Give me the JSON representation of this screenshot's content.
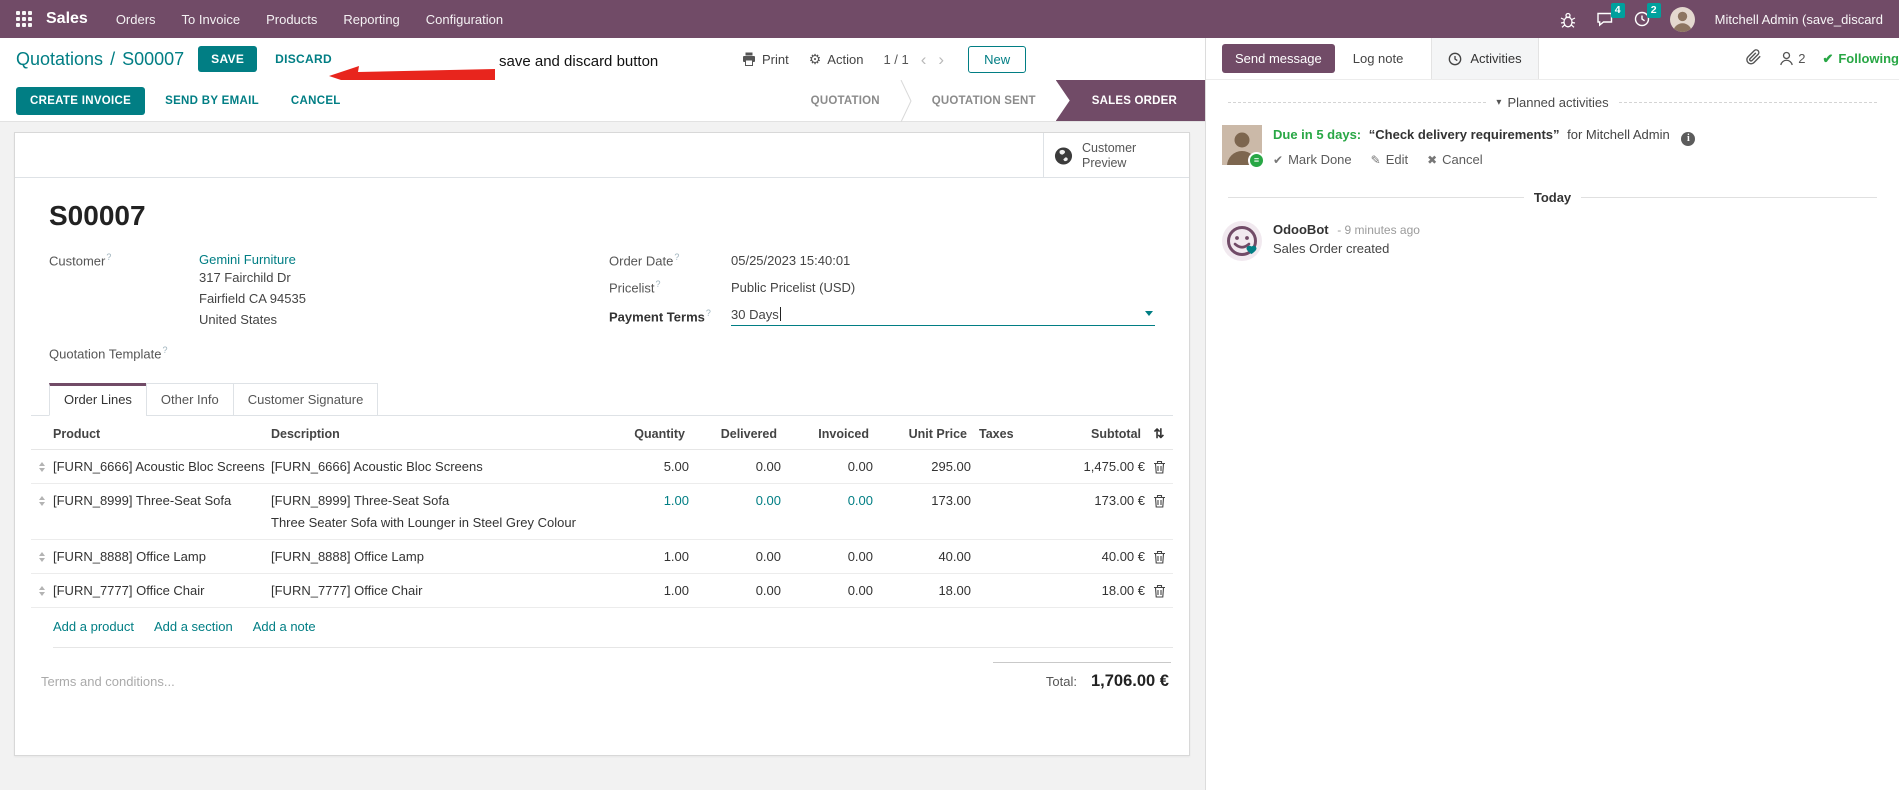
{
  "help_marker": "?",
  "nav": {
    "app_name": "Sales",
    "items": [
      "Orders",
      "To Invoice",
      "Products",
      "Reporting",
      "Configuration"
    ],
    "message_badge": "4",
    "activity_badge": "2",
    "user_name": "Mitchell Admin (save_discard",
    "accent_color": "#714B67"
  },
  "control": {
    "breadcrumb_parent": "Quotations",
    "breadcrumb_sep": "/",
    "breadcrumb_current": "S00007",
    "save": "SAVE",
    "discard": "DISCARD",
    "annotation": "save and discard button",
    "print": "Print",
    "action": "Action",
    "pager": "1 / 1",
    "new": "New"
  },
  "statusbar": {
    "create_invoice": "CREATE INVOICE",
    "send_by_email": "SEND BY EMAIL",
    "cancel": "CANCEL",
    "stages": [
      "QUOTATION",
      "QUOTATION SENT",
      "SALES ORDER"
    ],
    "active_stage": "SALES ORDER"
  },
  "sheet": {
    "customer_preview": "Customer Preview",
    "title": "S00007",
    "customer_label": "Customer",
    "customer_name": "Gemini Furniture",
    "address": [
      "317 Fairchild Dr",
      "Fairfield CA 94535",
      "United States"
    ],
    "quotation_template_label": "Quotation Template",
    "order_date_label": "Order Date",
    "order_date": "05/25/2023 15:40:01",
    "pricelist_label": "Pricelist",
    "pricelist": "Public Pricelist (USD)",
    "payment_terms_label": "Payment Terms",
    "payment_terms": "30 Days",
    "tabs": [
      "Order Lines",
      "Other Info",
      "Customer Signature"
    ],
    "active_tab": "Order Lines",
    "table": {
      "headers": {
        "product": "Product",
        "description": "Description",
        "quantity": "Quantity",
        "delivered": "Delivered",
        "invoiced": "Invoiced",
        "unit_price": "Unit Price",
        "taxes": "Taxes",
        "subtotal": "Subtotal"
      },
      "rows": [
        {
          "product": "[FURN_6666] Acoustic Bloc Screens",
          "description": "[FURN_6666] Acoustic Bloc Screens",
          "description2": "",
          "quantity": "5.00",
          "delivered": "0.00",
          "invoiced": "0.00",
          "unit_price": "295.00",
          "taxes": "",
          "subtotal": "1,475.00 €"
        },
        {
          "product": "[FURN_8999] Three-Seat Sofa",
          "description": "[FURN_8999] Three-Seat Sofa",
          "description2": "Three Seater Sofa with Lounger in Steel Grey Colour",
          "quantity": "1.00",
          "delivered": "0.00",
          "invoiced": "0.00",
          "unit_price": "173.00",
          "taxes": "",
          "subtotal": "173.00 €"
        },
        {
          "product": "[FURN_8888] Office Lamp",
          "description": "[FURN_8888] Office Lamp",
          "description2": "",
          "quantity": "1.00",
          "delivered": "0.00",
          "invoiced": "0.00",
          "unit_price": "40.00",
          "taxes": "",
          "subtotal": "40.00 €"
        },
        {
          "product": "[FURN_7777] Office Chair",
          "description": "[FURN_7777] Office Chair",
          "description2": "",
          "quantity": "1.00",
          "delivered": "0.00",
          "invoiced": "0.00",
          "unit_price": "18.00",
          "taxes": "",
          "subtotal": "18.00 €"
        }
      ],
      "add_product": "Add a product",
      "add_section": "Add a section",
      "add_note": "Add a note"
    },
    "terms_placeholder": "Terms and conditions...",
    "total_label": "Total:",
    "total_value": "1,706.00 €"
  },
  "chatter": {
    "send_message": "Send message",
    "log_note": "Log note",
    "activities": "Activities",
    "followers_count": "2",
    "following": "Following",
    "planned_activities": "Planned activities",
    "activity": {
      "due": "Due in 5 days:",
      "summary": "“Check delivery requirements”",
      "assignee": "for Mitchell Admin",
      "mark_done": "Mark Done",
      "edit": "Edit",
      "cancel": "Cancel"
    },
    "today": "Today",
    "message": {
      "author": "OdooBot",
      "time": "- 9 minutes ago",
      "body": "Sales Order created"
    }
  }
}
